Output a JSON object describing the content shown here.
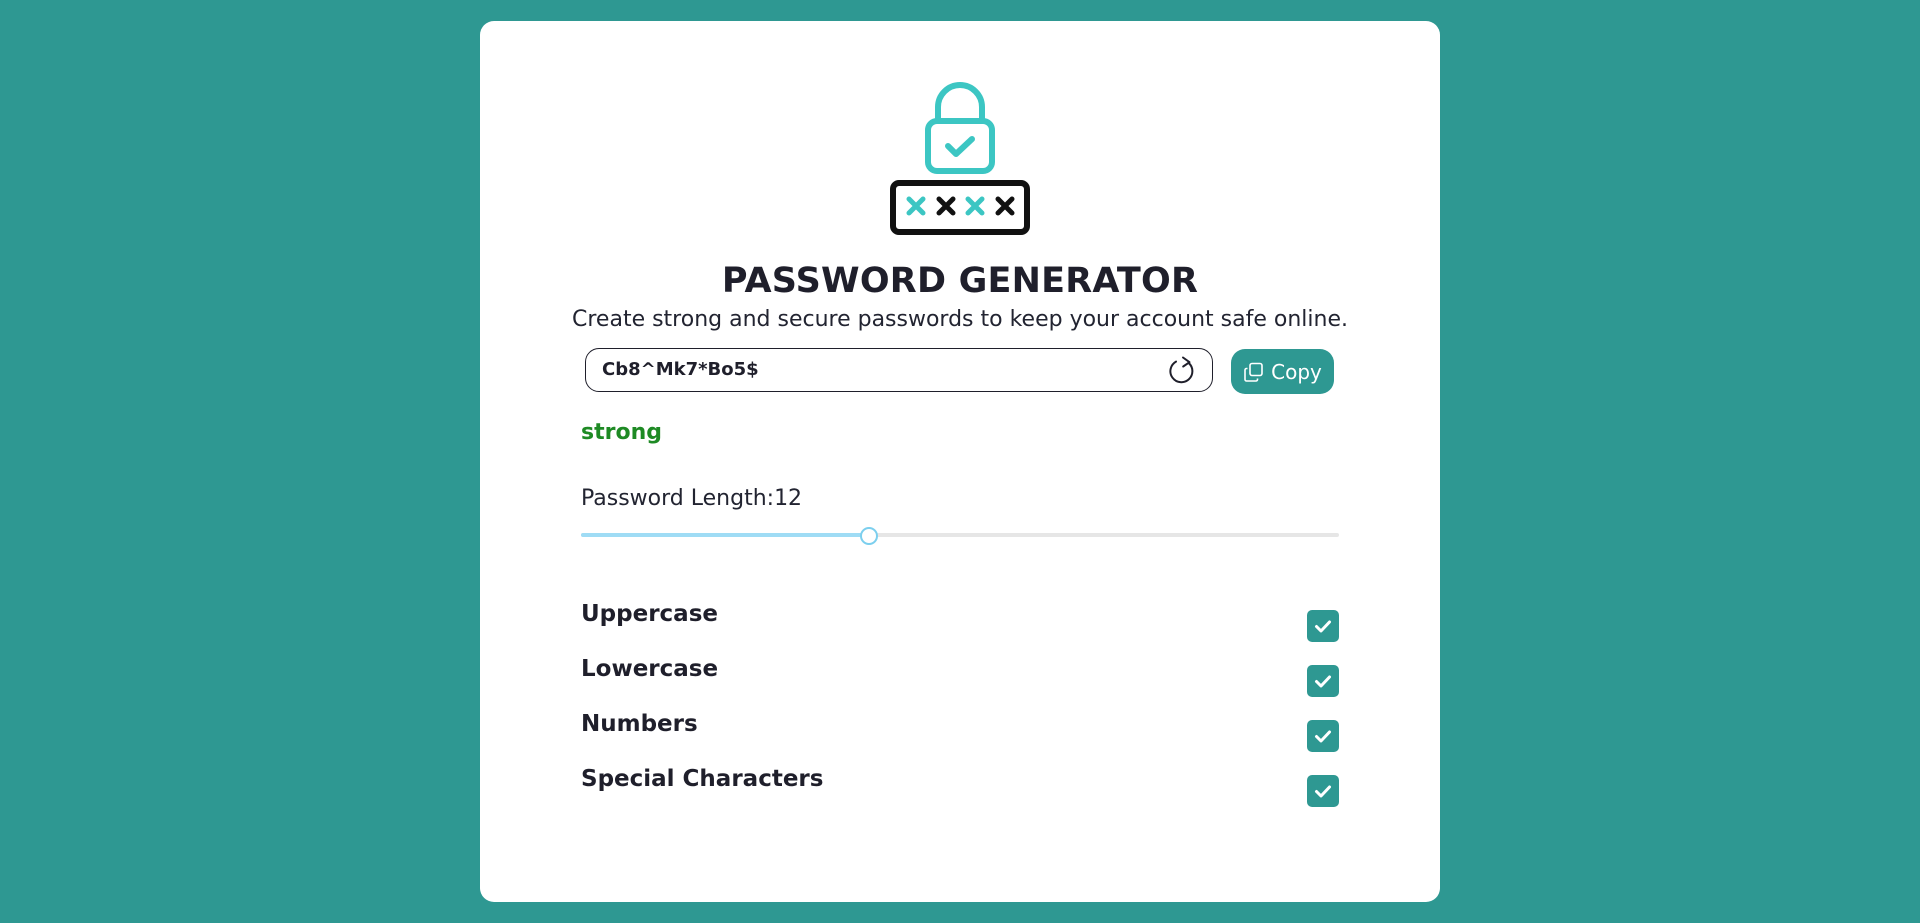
{
  "header": {
    "title": "PASSWORD GENERATOR",
    "subtitle": "Create strong and secure passwords to keep your account safe online."
  },
  "password": {
    "value": "Cb8^Mk7*Bo5$",
    "strength": "strong",
    "strength_color": "#1e8a24"
  },
  "copy_button": {
    "label": "Copy",
    "icon": "copy-icon"
  },
  "refresh_icon": "refresh-icon",
  "length": {
    "label": "Password Length:",
    "value": "12",
    "fill_fraction": 0.379
  },
  "options": [
    {
      "label": "Uppercase",
      "checked": true
    },
    {
      "label": "Lowercase",
      "checked": true
    },
    {
      "label": "Numbers",
      "checked": true
    },
    {
      "label": "Special Characters",
      "checked": true
    }
  ],
  "colors": {
    "background": "#2e9892",
    "accent": "#2e9892",
    "hero_accent": "#3cc6c3",
    "slider_fill": "#9fdcf5"
  }
}
